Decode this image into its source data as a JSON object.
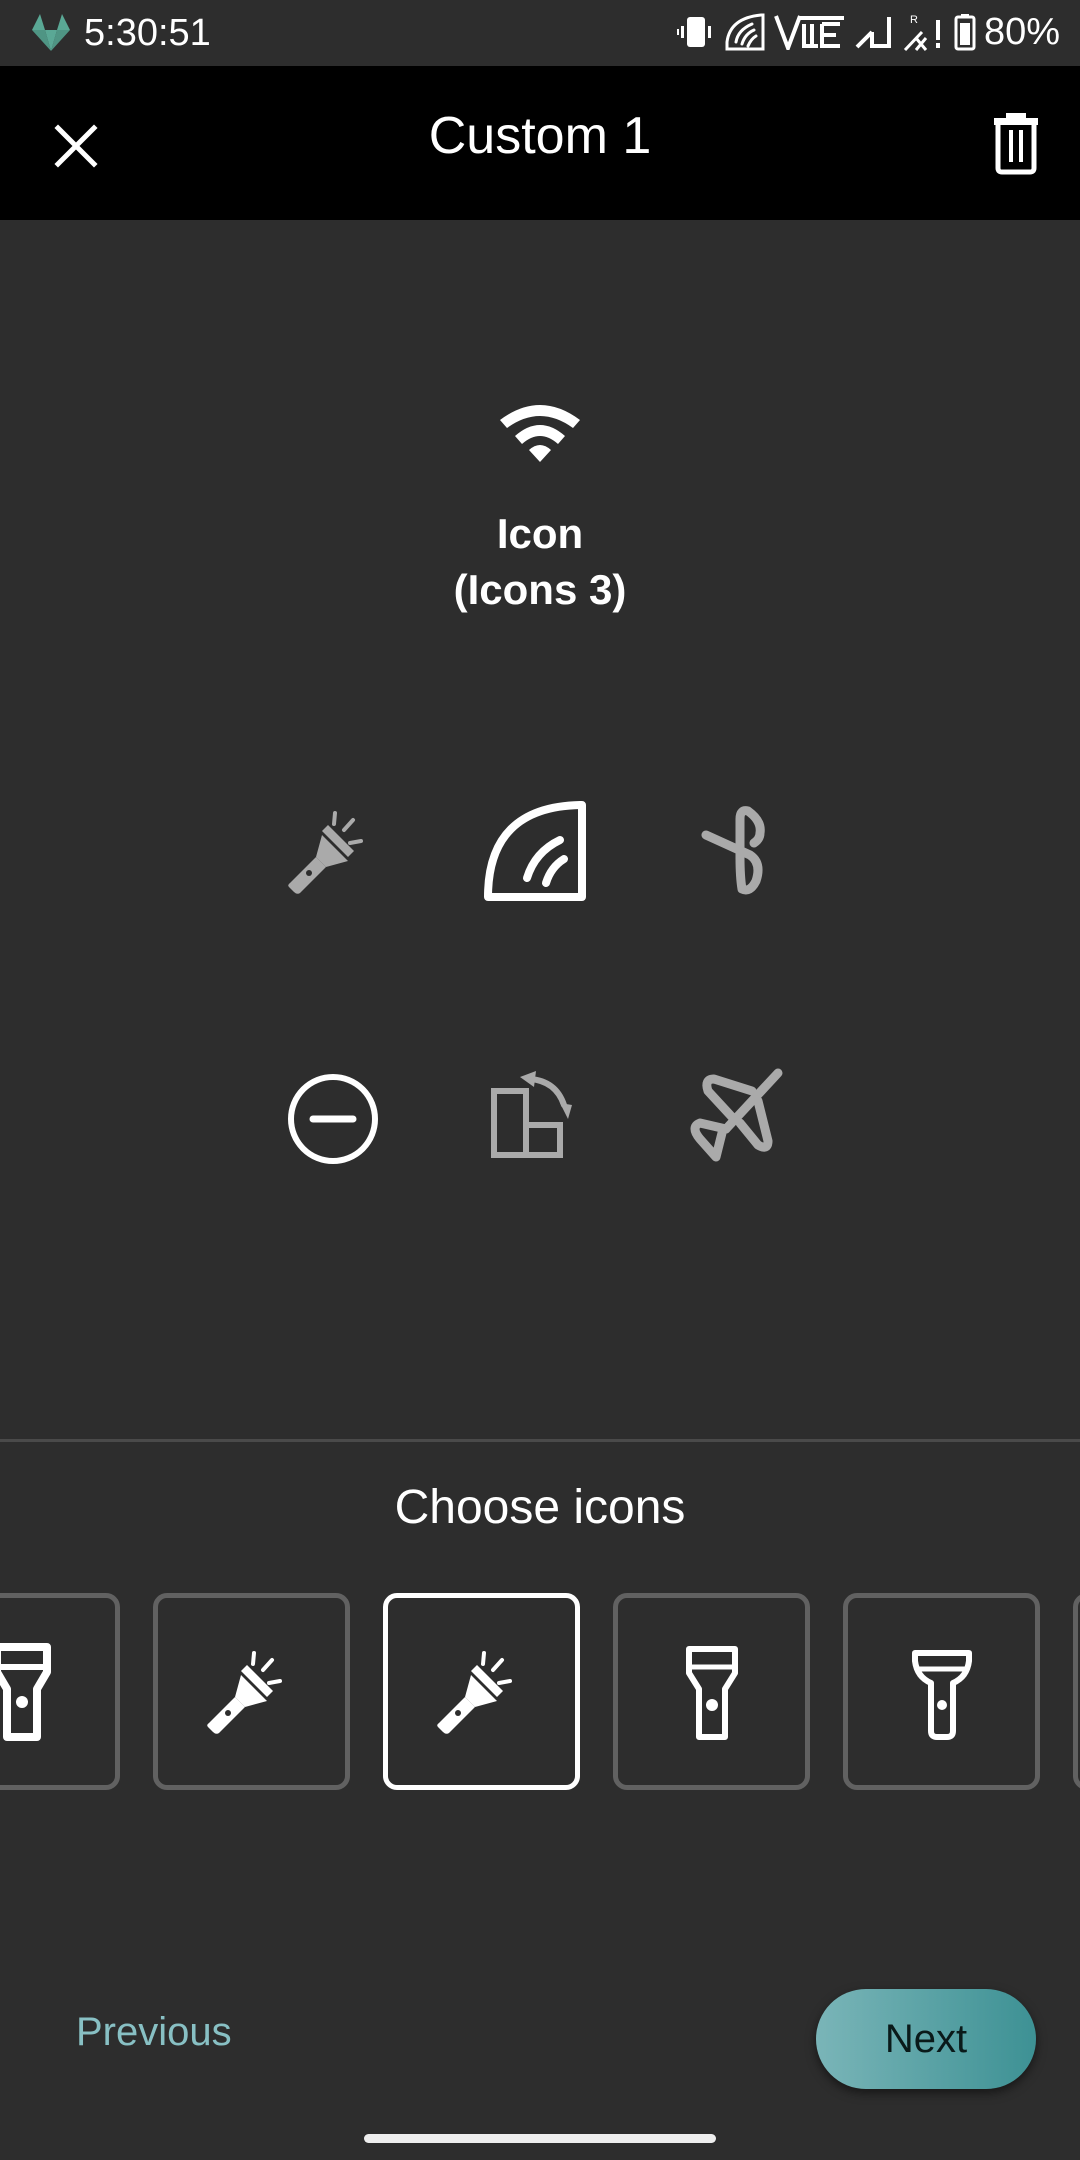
{
  "status_bar": {
    "time": "5:30:51",
    "battery": "80%",
    "icons": [
      "gitlab-logo-icon",
      "vibrate-icon",
      "hotspot-signal-icon",
      "volte-icon",
      "signal-icon",
      "roaming-no-data-signal-icon",
      "battery-icon"
    ]
  },
  "app_bar": {
    "title": "Custom 1",
    "close_icon": "close-icon",
    "delete_icon": "trash-icon"
  },
  "preview": {
    "icon": "wifi-icon",
    "label_line1": "Icon",
    "label_line2": "(Icons 3)"
  },
  "tile_grid": [
    {
      "icon": "flashlight-icon",
      "active": false
    },
    {
      "icon": "signal-quadrant-icon",
      "active": true
    },
    {
      "icon": "bluetooth-icon",
      "active": false
    },
    {
      "icon": "do-not-disturb-icon",
      "active": true
    },
    {
      "icon": "auto-rotate-icon",
      "active": false
    },
    {
      "icon": "airplane-mode-icon",
      "active": false
    }
  ],
  "chooser": {
    "title": "Choose icons",
    "options": [
      {
        "icon": "flashlight-outline-icon",
        "selected": false
      },
      {
        "icon": "flashlight-beam-icon",
        "selected": false
      },
      {
        "icon": "flashlight-beam-icon",
        "selected": true
      },
      {
        "icon": "flashlight-outline-icon",
        "selected": false
      },
      {
        "icon": "flashlight-rounded-icon",
        "selected": false
      }
    ]
  },
  "footer": {
    "previous_label": "Previous",
    "next_label": "Next"
  },
  "colors": {
    "background": "#2d2d2d",
    "app_bar": "#000000",
    "accent": "#88c0c4",
    "next_gradient_start": "#7ab5b8",
    "next_gradient_end": "#3d9194",
    "inactive_icon": "#aaaaaa",
    "tile_border": "#616161"
  }
}
